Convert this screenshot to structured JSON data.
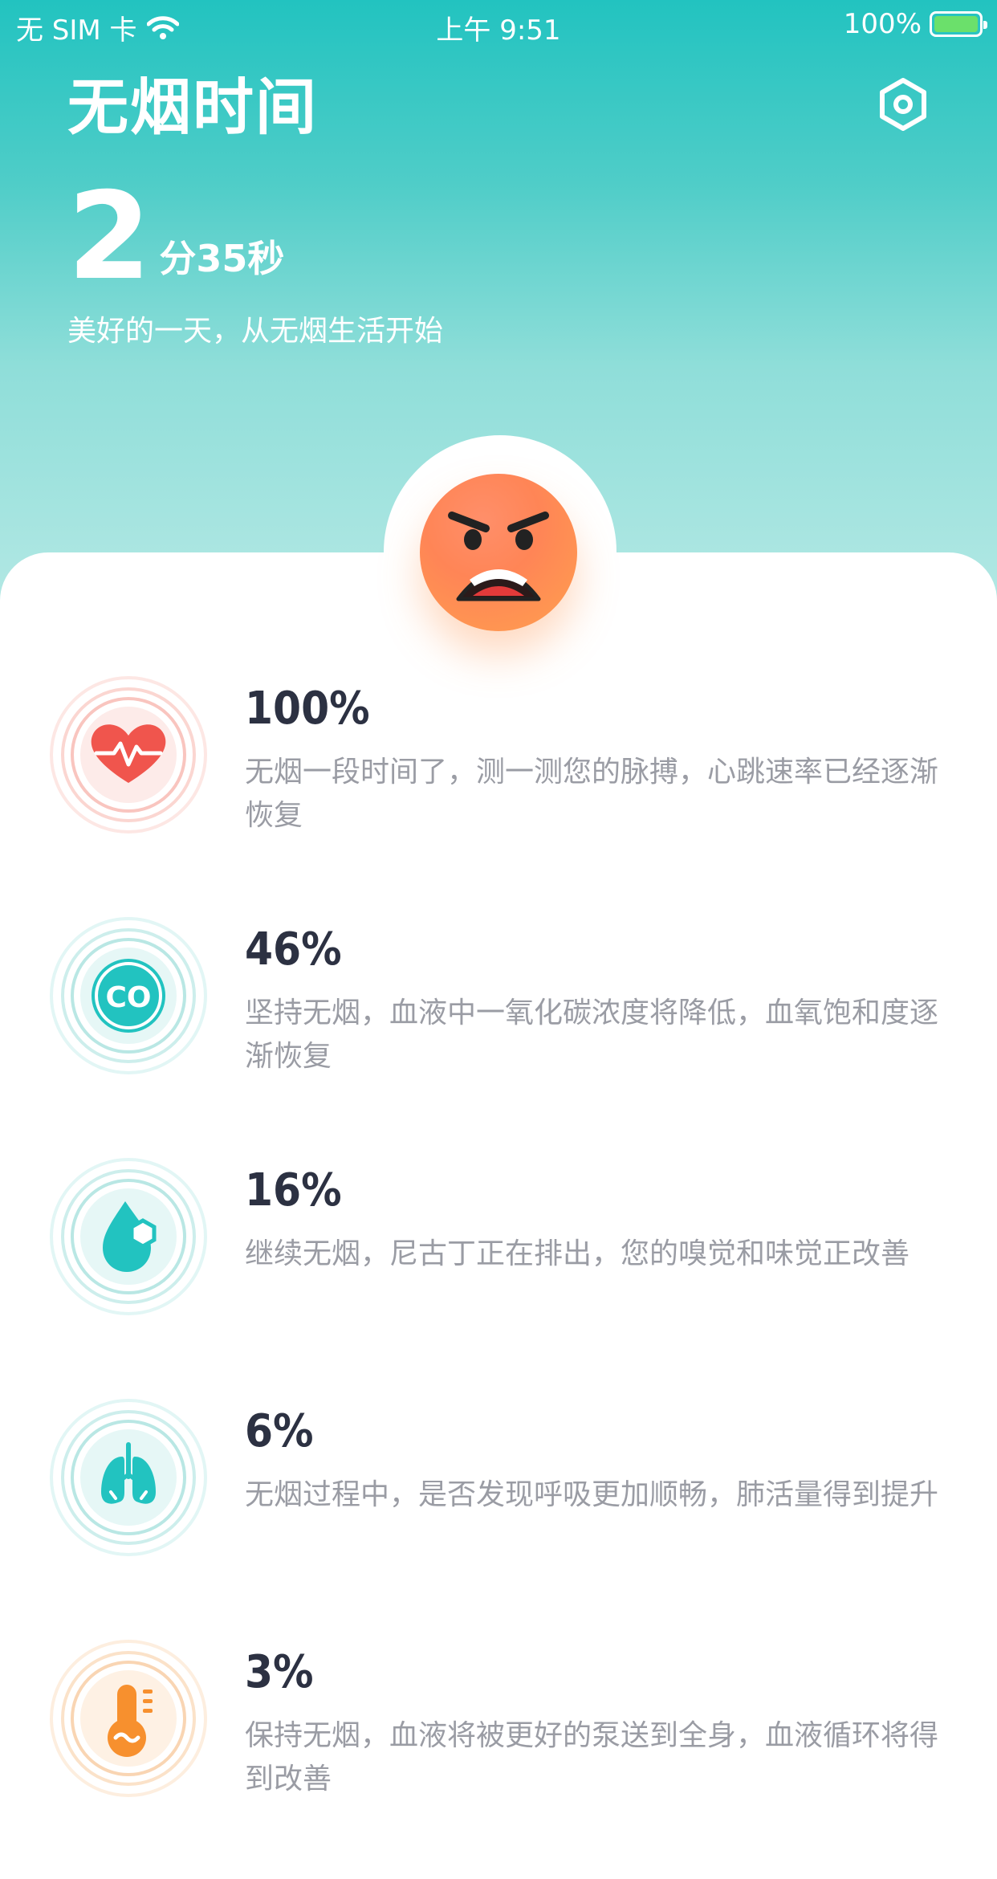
{
  "status_bar": {
    "carrier": "无 SIM 卡",
    "time": "上午 9:51",
    "battery": "100%"
  },
  "header": {
    "title": "无烟时间",
    "timer_big": "2",
    "timer_small": "分35秒",
    "slogan": "美好的一天，从无烟生活开始"
  },
  "mood_icon": "angry-face-icon",
  "colors": {
    "teal": "#22c3c0",
    "red": "#f0554d",
    "orange": "#f7902e",
    "text_dark": "#2c3142",
    "text_gray": "#9a9ca4"
  },
  "items": [
    {
      "percent": "100%",
      "icon": "heart-pulse-icon",
      "text": "无烟一段时间了，测一测您的脉搏，心跳速率已经逐渐恢复"
    },
    {
      "percent": "46%",
      "icon": "co-icon",
      "icon_text": "CO",
      "text": "坚持无烟，血液中一氧化碳浓度将降低，血氧饱和度逐渐恢复"
    },
    {
      "percent": "16%",
      "icon": "nicotine-drop-icon",
      "text": "继续无烟，尼古丁正在排出，您的嗅觉和味觉正改善"
    },
    {
      "percent": "6%",
      "icon": "lungs-icon",
      "text": "无烟过程中，是否发现呼吸更加顺畅，肺活量得到提升"
    },
    {
      "percent": "3%",
      "icon": "thermometer-icon",
      "text": "保持无烟，血液将被更好的泵送到全身，血液循环将得到改善"
    }
  ]
}
